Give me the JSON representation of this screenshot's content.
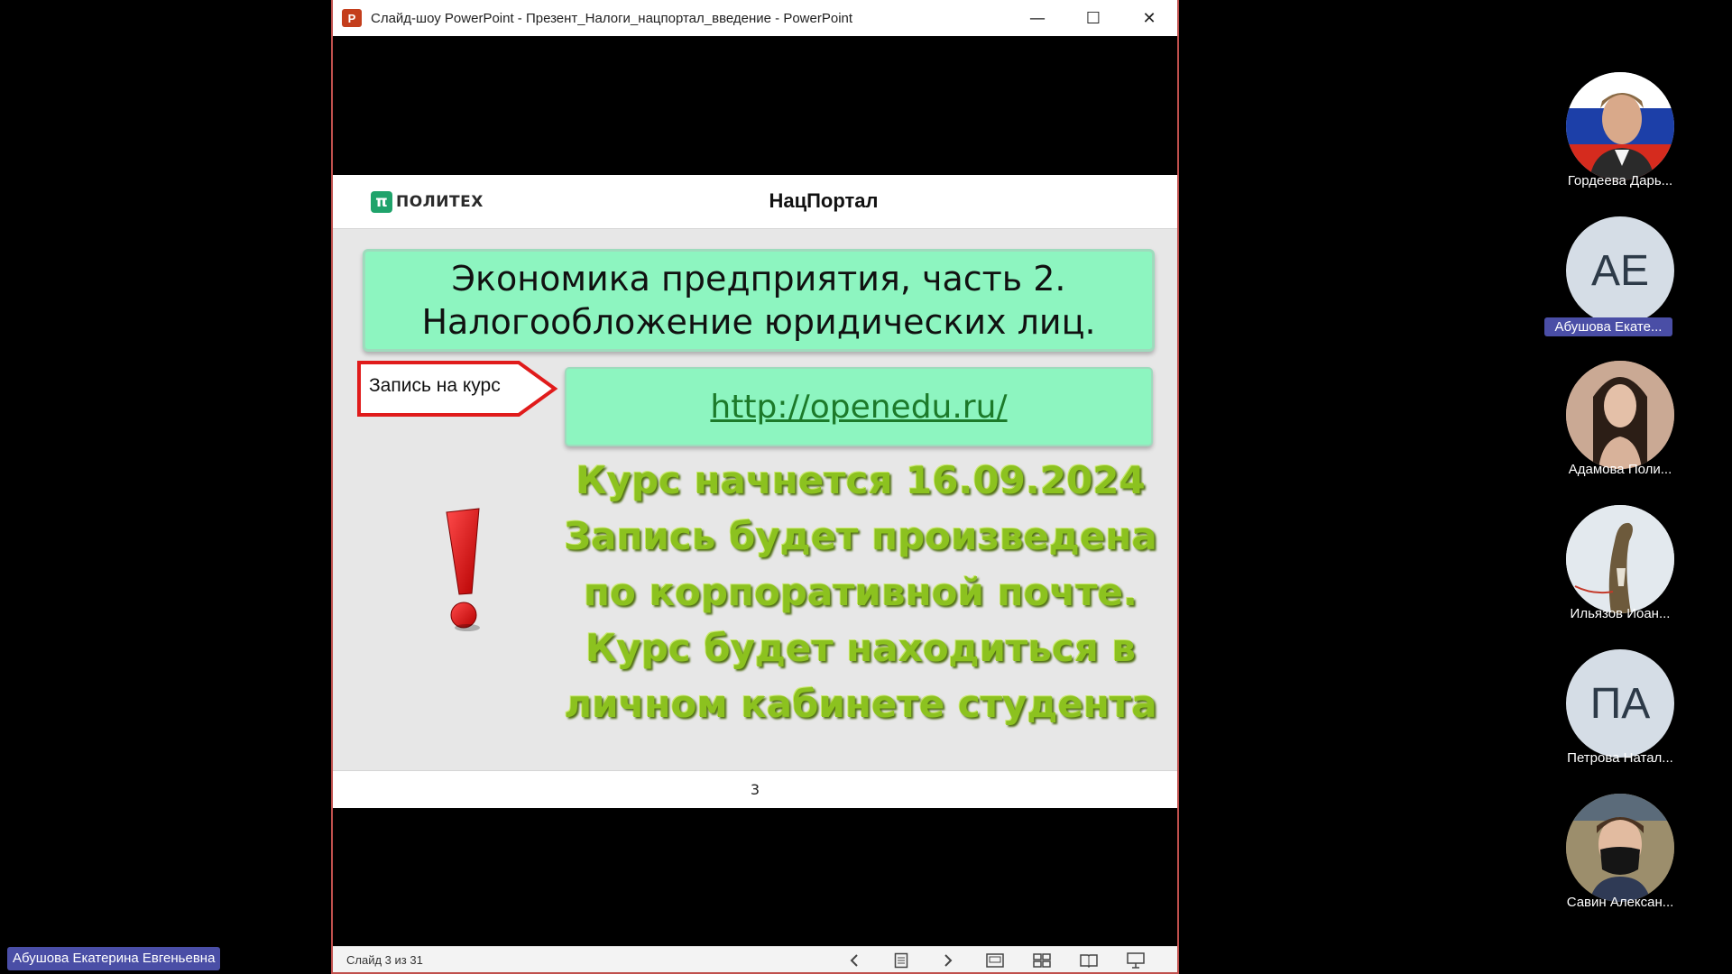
{
  "window": {
    "title": "Слайд-шоу PowerPoint  -  Презент_Налоги_нацпортал_введение - PowerPoint",
    "app_icon_letter": "P",
    "minimize": "—",
    "maximize": "☐",
    "close": "✕"
  },
  "slide": {
    "header": {
      "logo_text": "ПОЛИТЕХ",
      "logo_mark": "π",
      "title": "НацПортал"
    },
    "course_lines": [
      "Экономика предприятия, часть 2.",
      "Налогообложение юридических лиц."
    ],
    "callout_label": "Запись на курс",
    "link": "http://openedu.ru/",
    "notice_lines": [
      "Курс начнется 16.09.2024",
      "Запись будет произведена",
      "по корпоративной почте.",
      "Курс будет находиться в",
      "личном кабинете студента"
    ],
    "page_number": "3"
  },
  "statusbar": {
    "slide_counter": "Слайд 3 из 31",
    "icons": [
      "prev-icon",
      "notes-icon",
      "next-icon",
      "normal-view-icon",
      "slide-sorter-icon",
      "reading-view-icon",
      "slideshow-icon"
    ]
  },
  "participants": [
    {
      "name": "Гордеева Дарь...",
      "initials": "",
      "avatar": "photo-flag"
    },
    {
      "name": "Абушова Екате...",
      "initials": "АЕ",
      "active": true
    },
    {
      "name": "Адамова Поли...",
      "initials": "",
      "avatar": "photo-woman"
    },
    {
      "name": "Ильязов Иоан...",
      "initials": "",
      "avatar": "photo-lizard"
    },
    {
      "name": "Петрова Натал...",
      "initials": "ПА"
    },
    {
      "name": "Савин Алексан...",
      "initials": "",
      "avatar": "photo-man-mask"
    }
  ],
  "presenter": "Абушова Екатерина Евгеньевна",
  "colors": {
    "accent_green_box": "#8df5c0",
    "notice_text": "#8cc21f",
    "callout_border": "#e01b1b",
    "participant_highlight": "#4a4ea6"
  }
}
